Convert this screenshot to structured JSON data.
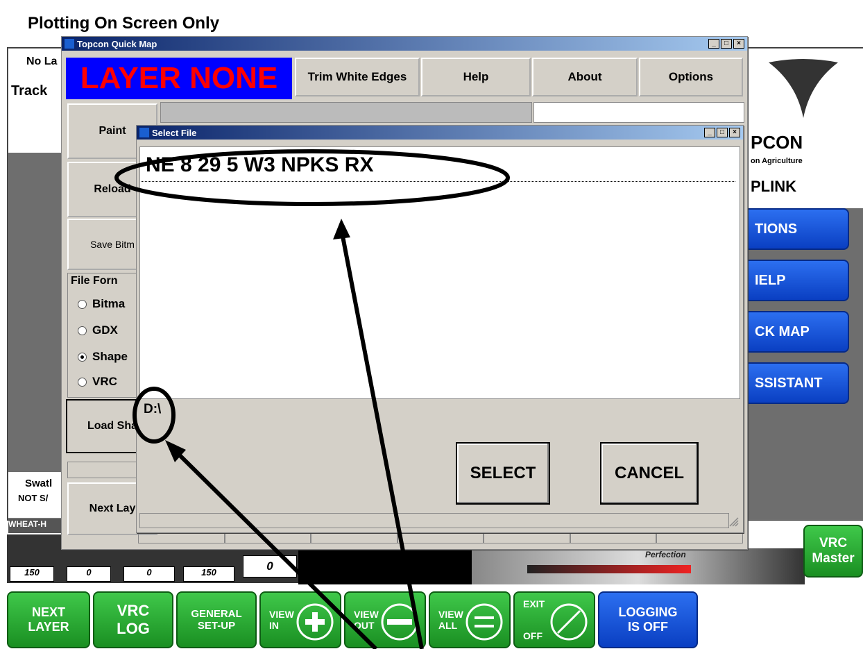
{
  "screen": {
    "title": "Plotting On Screen Only",
    "left_labels": [
      "No La",
      "Track"
    ],
    "swath_label": "Swatl",
    "swath_status": "NOT S/",
    "field_label": "WHEAT-H",
    "counters": [
      "150",
      "0",
      "0",
      "150"
    ],
    "display_value": "0",
    "brand_text": "Perfection"
  },
  "right_panel": {
    "logo_text": "PCON",
    "logo_sub": "on Agriculture",
    "logo_link": "PLINK",
    "buttons": [
      "TIONS",
      "IELP",
      "CK MAP",
      "SSISTANT"
    ],
    "vrc_master": [
      "VRC",
      "Master"
    ]
  },
  "quickmap": {
    "title": "Topcon Quick Map",
    "layer_label": "LAYER NONE",
    "toolbar": [
      "Trim White Edges",
      "Help",
      "About",
      "Options"
    ],
    "side_buttons": [
      "Paint",
      "Reload",
      "Save Bitm",
      "Load Sha",
      "Next Lay"
    ],
    "file_format_label": "File Forn",
    "formats": [
      {
        "label": "Bitma",
        "selected": false
      },
      {
        "label": "GDX",
        "selected": false
      },
      {
        "label": "Shape",
        "selected": true
      },
      {
        "label": "VRC",
        "selected": false
      }
    ]
  },
  "select_file": {
    "title": "Select File",
    "files": [
      "NE 8 29 5 W3 NPKS RX"
    ],
    "path": "D:\\",
    "select_label": "SELECT",
    "cancel_label": "CANCEL"
  },
  "bottom_bar": {
    "buttons": [
      {
        "line1": "NEXT",
        "line2": "LAYER"
      },
      {
        "line1": "VRC",
        "line2": "LOG"
      },
      {
        "line1": "GENERAL",
        "line2": "SET-UP"
      },
      {
        "line1": "VIEW",
        "line2": "IN"
      },
      {
        "line1": "VIEW",
        "line2": "OUT"
      },
      {
        "line1": "VIEW",
        "line2": "ALL"
      },
      {
        "line1": "EXIT",
        "line2": "OFF"
      },
      {
        "line1": "LOGGING",
        "line2": "IS OFF"
      }
    ]
  },
  "colors": {
    "layer_bg": "#0000ff",
    "layer_text": "#ff0000",
    "green_button": "#1a8f22",
    "blue_button": "#0a3fc2"
  }
}
